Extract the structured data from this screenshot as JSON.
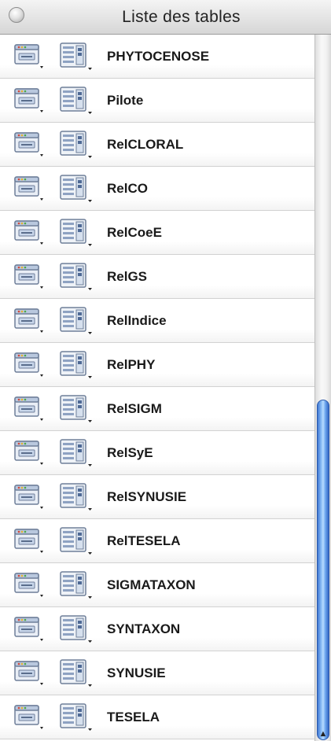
{
  "window": {
    "title": "Liste des tables"
  },
  "rows": [
    {
      "label": "PHYTOCENOSE"
    },
    {
      "label": "Pilote"
    },
    {
      "label": "RelCLORAL"
    },
    {
      "label": "RelCO"
    },
    {
      "label": "RelCoeE"
    },
    {
      "label": "RelGS"
    },
    {
      "label": "RelIndice"
    },
    {
      "label": "RelPHY"
    },
    {
      "label": "RelSIGM"
    },
    {
      "label": "RelSyE"
    },
    {
      "label": "RelSYNUSIE"
    },
    {
      "label": "RelTESELA"
    },
    {
      "label": "SIGMATAXON"
    },
    {
      "label": "SYNTAXON"
    },
    {
      "label": "SYNUSIE"
    },
    {
      "label": "TESELA"
    }
  ],
  "icons": {
    "window_icon": "table-window-icon",
    "form_icon": "form-layout-icon",
    "scroll_arrow": "scroll-down-arrow-icon"
  },
  "colors": {
    "scroll_thumb": "#5f9ae8",
    "titlebar": "#e2e2e2"
  }
}
